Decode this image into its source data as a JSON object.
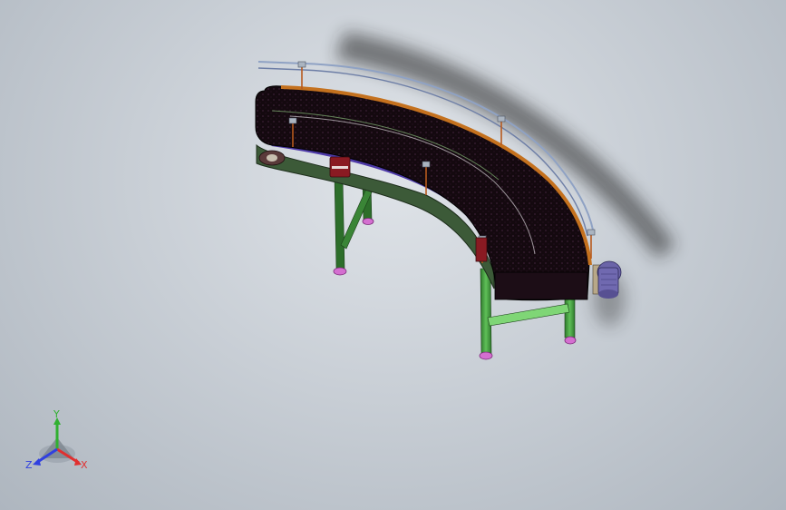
{
  "viewport": {
    "background_top": "#dfe3e8",
    "background_bottom": "#aeb6bf"
  },
  "model": {
    "description_icon": "curved-belt-conveyor-icon",
    "belt_color": "#140a12",
    "rail_color": "#c4711e",
    "frame_color": "#2f6b2c",
    "leg_color": "#3e8f3a",
    "foot_color": "#d46fd0",
    "motor_color": "#6b64a8",
    "guide_color": "#8fa2c4"
  },
  "triad": {
    "x_label": "X",
    "y_label": "Y",
    "z_label": "Z",
    "x_color": "#e03030",
    "y_color": "#30b030",
    "z_color": "#3040e0"
  }
}
